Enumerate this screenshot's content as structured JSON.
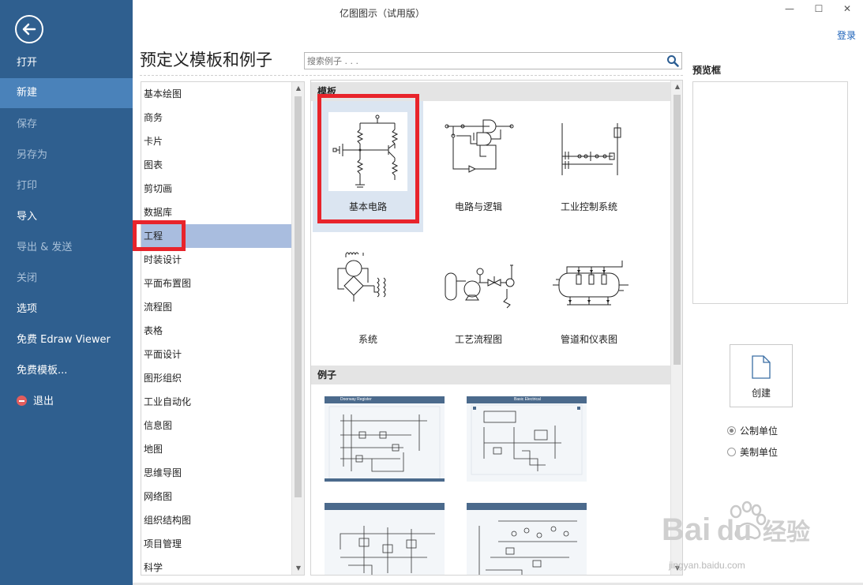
{
  "window": {
    "title": "亿图图示（试用版）",
    "controls": {
      "minimize": "—",
      "maximize": "☐",
      "close": "✕"
    },
    "login": "登录"
  },
  "sidebar": {
    "items": [
      {
        "label": "打开",
        "state": "normal"
      },
      {
        "label": "新建",
        "state": "active"
      },
      {
        "label": "保存",
        "state": "disabled"
      },
      {
        "label": "另存为",
        "state": "disabled"
      },
      {
        "label": "打印",
        "state": "disabled"
      },
      {
        "label": "导入",
        "state": "normal"
      },
      {
        "label": "导出 & 发送",
        "state": "disabled"
      },
      {
        "label": "关闭",
        "state": "disabled"
      },
      {
        "label": "选项",
        "state": "normal"
      },
      {
        "label": "免费 Edraw Viewer",
        "state": "normal"
      },
      {
        "label": "免费模板...",
        "state": "normal"
      },
      {
        "label": "退出",
        "state": "normal",
        "icon": "exit-icon"
      }
    ]
  },
  "main": {
    "title": "预定义模板和例子",
    "search": {
      "placeholder": "搜索例子 . . .",
      "value": ""
    }
  },
  "categories": {
    "selected": "工程",
    "items": [
      "基本绘图",
      "商务",
      "卡片",
      "图表",
      "剪切画",
      "数据库",
      "工程",
      "时装设计",
      "平面布置图",
      "流程图",
      "表格",
      "平面设计",
      "图形组织",
      "工业自动化",
      "信息图",
      "地图",
      "思维导图",
      "网络图",
      "组织结构图",
      "项目管理",
      "科学"
    ]
  },
  "templates": {
    "section_label": "模板",
    "selected": "基本电路",
    "items": [
      {
        "label": "基本电路",
        "icon": "basic-circuit-icon"
      },
      {
        "label": "电路与逻辑",
        "icon": "circuit-logic-icon"
      },
      {
        "label": "工业控制系统",
        "icon": "industrial-control-icon"
      },
      {
        "label": "系统",
        "icon": "system-icon"
      },
      {
        "label": "工艺流程图",
        "icon": "process-flow-icon"
      },
      {
        "label": "管道和仪表图",
        "icon": "pipe-instrument-icon"
      }
    ]
  },
  "examples": {
    "section_label": "例子",
    "items": [
      {
        "title": "Doorway Register"
      },
      {
        "title": "Basic Electrical"
      },
      {
        "title": ""
      },
      {
        "title": ""
      }
    ]
  },
  "preview": {
    "label": "预览框"
  },
  "create": {
    "label": "创建"
  },
  "units": {
    "options": [
      {
        "label": "公制单位",
        "checked": true
      },
      {
        "label": "美制单位",
        "checked": false
      }
    ]
  },
  "watermark": {
    "text": "Bai du 经验",
    "sub": "jingyan.baidu.com"
  },
  "colors": {
    "sidebar": "#2f5f8f",
    "sidebar_active": "#4a82ba",
    "selection": "#a9bddf",
    "highlight": "#e8242b",
    "link": "#1c62b9"
  }
}
